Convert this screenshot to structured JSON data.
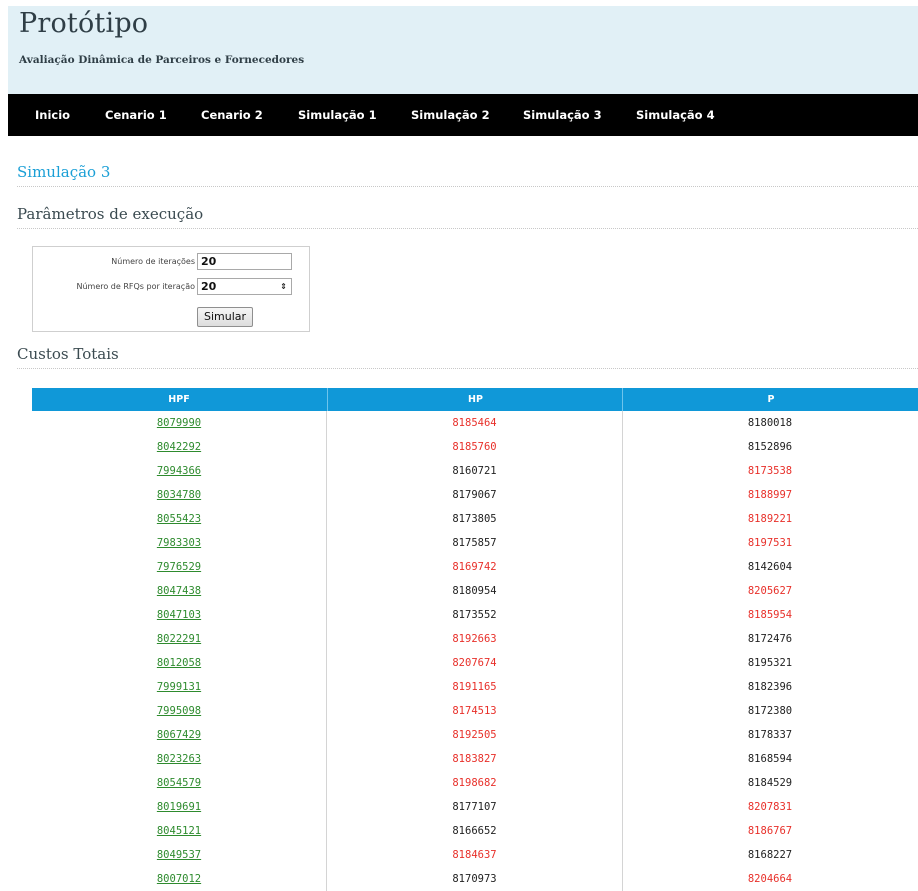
{
  "header": {
    "title": "Protótipo",
    "subtitle": "Avaliação Dinâmica de Parceiros e Fornecedores"
  },
  "nav": [
    "Inicio",
    "Cenario 1",
    "Cenario 2",
    "Simulação 1",
    "Simulação 2",
    "Simulação 3",
    "Simulação 4"
  ],
  "page": {
    "title": "Simulação 3",
    "params_heading": "Parâmetros de execução",
    "costs_heading": "Custos Totais"
  },
  "form": {
    "iterations_label": "Número de iterações",
    "iterations_value": "20",
    "rfqs_label": "Número de RFQs por iteração",
    "rfqs_value": "20",
    "submit_label": "Simular"
  },
  "table": {
    "headers": [
      "HPF",
      "HP",
      "P"
    ],
    "rows": [
      {
        "hpf": "8079990",
        "hp": "8185464",
        "p": "8180018",
        "hp_color": "red",
        "p_color": "black"
      },
      {
        "hpf": "8042292",
        "hp": "8185760",
        "p": "8152896",
        "hp_color": "red",
        "p_color": "black"
      },
      {
        "hpf": "7994366",
        "hp": "8160721",
        "p": "8173538",
        "hp_color": "black",
        "p_color": "red"
      },
      {
        "hpf": "8034780",
        "hp": "8179067",
        "p": "8188997",
        "hp_color": "black",
        "p_color": "red"
      },
      {
        "hpf": "8055423",
        "hp": "8173805",
        "p": "8189221",
        "hp_color": "black",
        "p_color": "red"
      },
      {
        "hpf": "7983303",
        "hp": "8175857",
        "p": "8197531",
        "hp_color": "black",
        "p_color": "red"
      },
      {
        "hpf": "7976529",
        "hp": "8169742",
        "p": "8142604",
        "hp_color": "red",
        "p_color": "black"
      },
      {
        "hpf": "8047438",
        "hp": "8180954",
        "p": "8205627",
        "hp_color": "black",
        "p_color": "red"
      },
      {
        "hpf": "8047103",
        "hp": "8173552",
        "p": "8185954",
        "hp_color": "black",
        "p_color": "red"
      },
      {
        "hpf": "8022291",
        "hp": "8192663",
        "p": "8172476",
        "hp_color": "red",
        "p_color": "black"
      },
      {
        "hpf": "8012058",
        "hp": "8207674",
        "p": "8195321",
        "hp_color": "red",
        "p_color": "black"
      },
      {
        "hpf": "7999131",
        "hp": "8191165",
        "p": "8182396",
        "hp_color": "red",
        "p_color": "black"
      },
      {
        "hpf": "7995098",
        "hp": "8174513",
        "p": "8172380",
        "hp_color": "red",
        "p_color": "black"
      },
      {
        "hpf": "8067429",
        "hp": "8192505",
        "p": "8178337",
        "hp_color": "red",
        "p_color": "black"
      },
      {
        "hpf": "8023263",
        "hp": "8183827",
        "p": "8168594",
        "hp_color": "red",
        "p_color": "black"
      },
      {
        "hpf": "8054579",
        "hp": "8198682",
        "p": "8184529",
        "hp_color": "red",
        "p_color": "black"
      },
      {
        "hpf": "8019691",
        "hp": "8177107",
        "p": "8207831",
        "hp_color": "black",
        "p_color": "red"
      },
      {
        "hpf": "8045121",
        "hp": "8166652",
        "p": "8186767",
        "hp_color": "black",
        "p_color": "red"
      },
      {
        "hpf": "8049537",
        "hp": "8184637",
        "p": "8168227",
        "hp_color": "red",
        "p_color": "black"
      },
      {
        "hpf": "8007012",
        "hp": "8170973",
        "p": "8204664",
        "hp_color": "black",
        "p_color": "red"
      }
    ]
  },
  "colors": {
    "header_bg": "#e1f0f6",
    "nav_bg": "#000000",
    "accent": "#1a9fd6",
    "table_header": "#1098d8",
    "best": "#2e8b2e",
    "worst": "#e8302a"
  }
}
